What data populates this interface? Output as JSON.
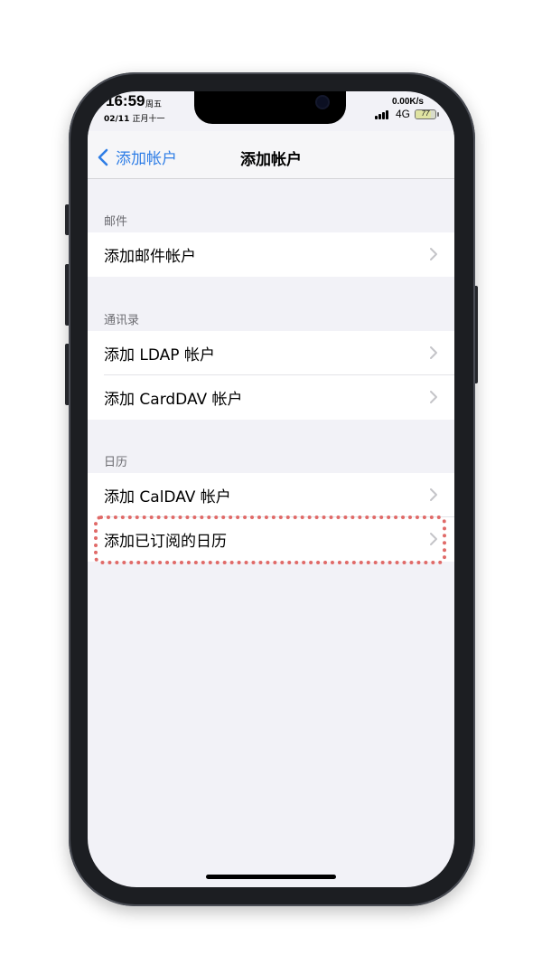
{
  "status_bar": {
    "time": "16:59",
    "weekday": "周五",
    "date": "02/11",
    "lunar_date": "正月十一",
    "net_speed": "0.00K/s",
    "network": "4G",
    "battery": "77",
    "battery_fraction": 0.77
  },
  "nav": {
    "back_label": "添加帐户",
    "title": "添加帐户"
  },
  "sections": {
    "mail": {
      "header": "邮件",
      "items": [
        "添加邮件帐户"
      ]
    },
    "contacts": {
      "header": "通讯录",
      "items": [
        "添加 LDAP 帐户",
        "添加 CardDAV 帐户"
      ]
    },
    "calendar": {
      "header": "日历",
      "items": [
        "添加 CalDAV 帐户",
        "添加已订阅的日历"
      ]
    }
  },
  "colors": {
    "accent": "#2f7ee6",
    "highlight": "#e06a68",
    "background": "#f2f2f7"
  },
  "icons": {
    "back": "chevron-left-icon",
    "row": "chevron-right-icon"
  }
}
